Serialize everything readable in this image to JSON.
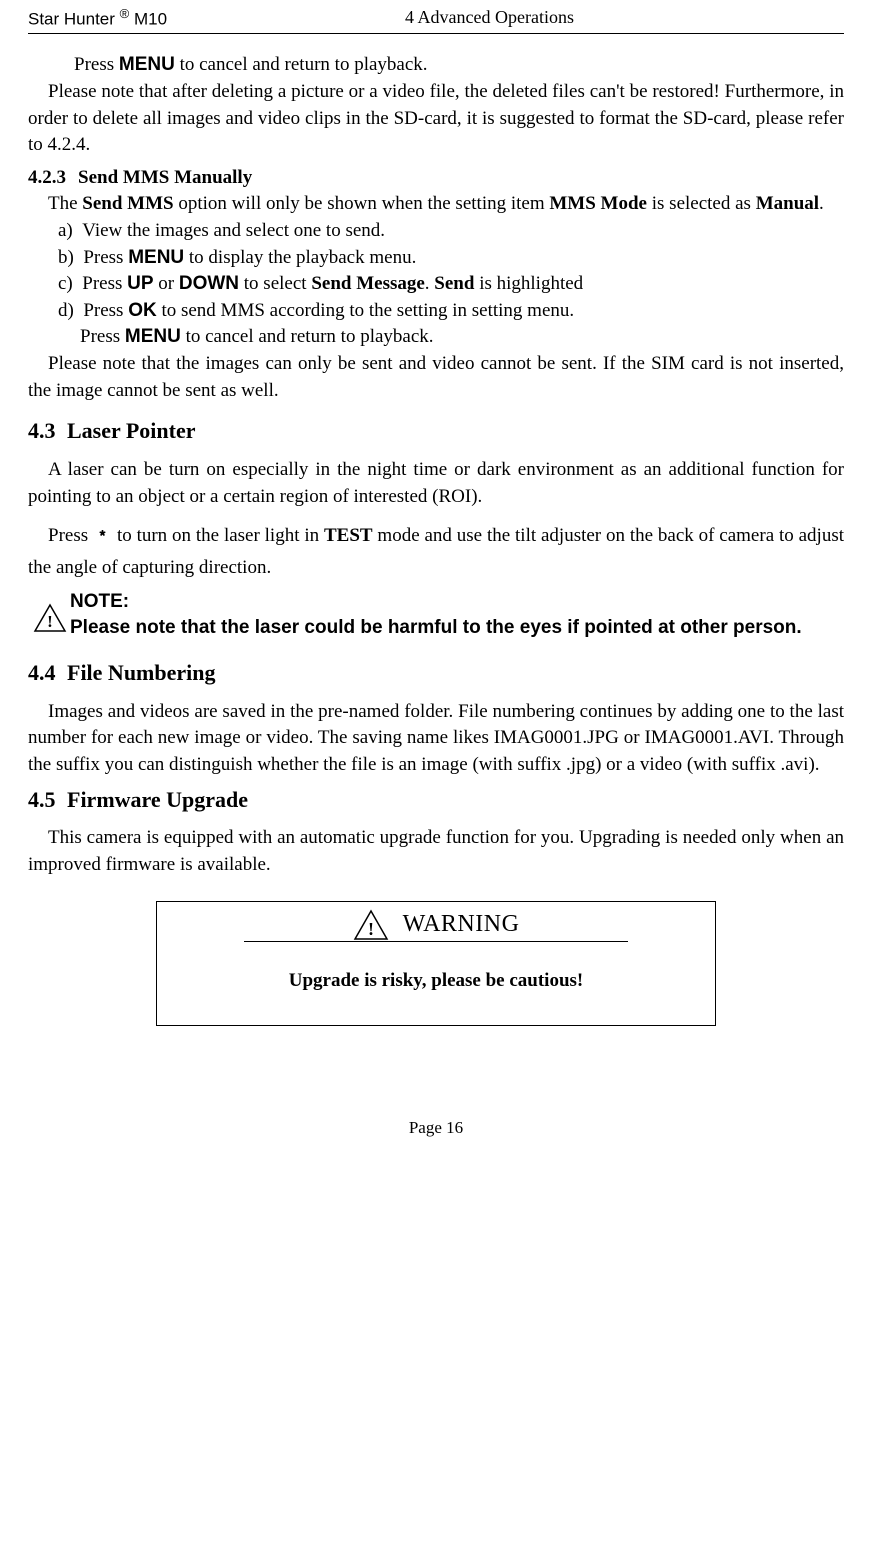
{
  "header": {
    "product": "Star Hunter",
    "reg": "®",
    "model": "M10",
    "chapter": "4 Advanced Operations"
  },
  "body": {
    "p1_line1": "Press ",
    "p1_menu": "MENU",
    "p1_line1b": " to cancel and return to playback.",
    "p2": "Please note that after deleting a picture or a video file, the deleted files can't be restored! Furthermore, in order to delete all images and video clips in the SD-card, it is suggested to format the SD-card, please refer to 4.2.4.",
    "h423_num": "4.2.3",
    "h423_title": "Send MMS Manually",
    "p3_a": "The ",
    "p3_b": "Send MMS",
    "p3_c": " option will only be shown when the setting item ",
    "p3_d": "MMS Mode",
    "p3_e": " is selected as ",
    "p3_f": "Manual",
    "p3_g": ".",
    "list": {
      "a": "View the images and select one to send.",
      "b_1": "Press ",
      "b_2": "MENU",
      "b_3": " to display the playback menu.",
      "c_1": "Press ",
      "c_2": "UP",
      "c_3": " or ",
      "c_4": "DOWN",
      "c_5": " to select ",
      "c_6": "Send Message",
      "c_7": ". ",
      "c_8": "Send",
      "c_9": " is highlighted",
      "d_1": "Press ",
      "d_2": "OK",
      "d_3": " to send MMS according to the setting in setting menu.",
      "d_ext1": "Press ",
      "d_ext2": "MENU",
      "d_ext3": " to cancel and return to playback."
    },
    "p4": "Please note that the images can only be sent and video cannot be sent. If the SIM card is not inserted, the image cannot be sent as well.",
    "h43_num": "4.3",
    "h43_title": "Laser Pointer",
    "p5": "A laser can be turn on especially in the night time or dark environment as an additional function for pointing to an object or a certain region of interested (ROI).",
    "p6_a": "Press ",
    "p6_star": "﹡",
    "p6_b": " to turn on the laser light in ",
    "p6_c": "TEST",
    "p6_d": " mode and use the tilt adjuster on the back of camera to adjust the angle of capturing direction.",
    "note_title": "NOTE:",
    "note_body": "Please note that the laser could be harmful to the eyes if pointed at other person.",
    "h44_num": "4.4",
    "h44_title": "File Numbering",
    "p7": "Images and videos are saved in the pre-named folder. File numbering continues by adding one to the last number for each new image or video. The saving name likes IMAG0001.JPG or IMAG0001.AVI. Through the suffix you can distinguish whether the file is an image (with suffix .jpg) or a video (with suffix .avi).",
    "h45_num": "4.5",
    "h45_title": "Firmware Upgrade",
    "p8": "This camera is equipped with an automatic upgrade function for you. Upgrading is needed only when an improved firmware is available.",
    "warning_title": "WARNING",
    "warning_body": "Upgrade is risky, please be cautious!"
  },
  "footer": {
    "page": "Page 16"
  }
}
